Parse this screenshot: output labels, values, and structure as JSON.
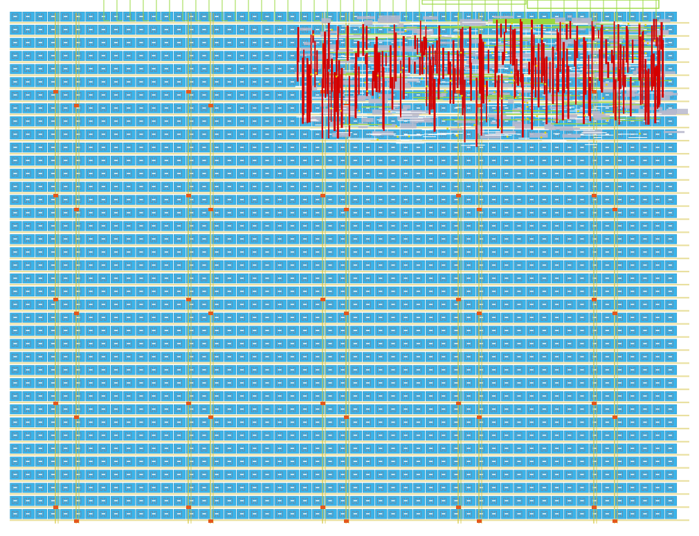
{
  "diagram": {
    "colors": {
      "background": "#ffffff",
      "cell_fill": "#3ab4ea",
      "cell_outline": "#2f8fbf",
      "cell_pin": "#7a7a8c",
      "power_rail": "#e9e0a0",
      "guide_line": "#d4c63a",
      "route_green": "#9ad840",
      "route_red": "#d40000",
      "route_gray": "#b9b9cc",
      "route_yellow": "#e8d800",
      "route_white": "#ffffff",
      "io_marker": "#e4571c"
    }
  }
}
